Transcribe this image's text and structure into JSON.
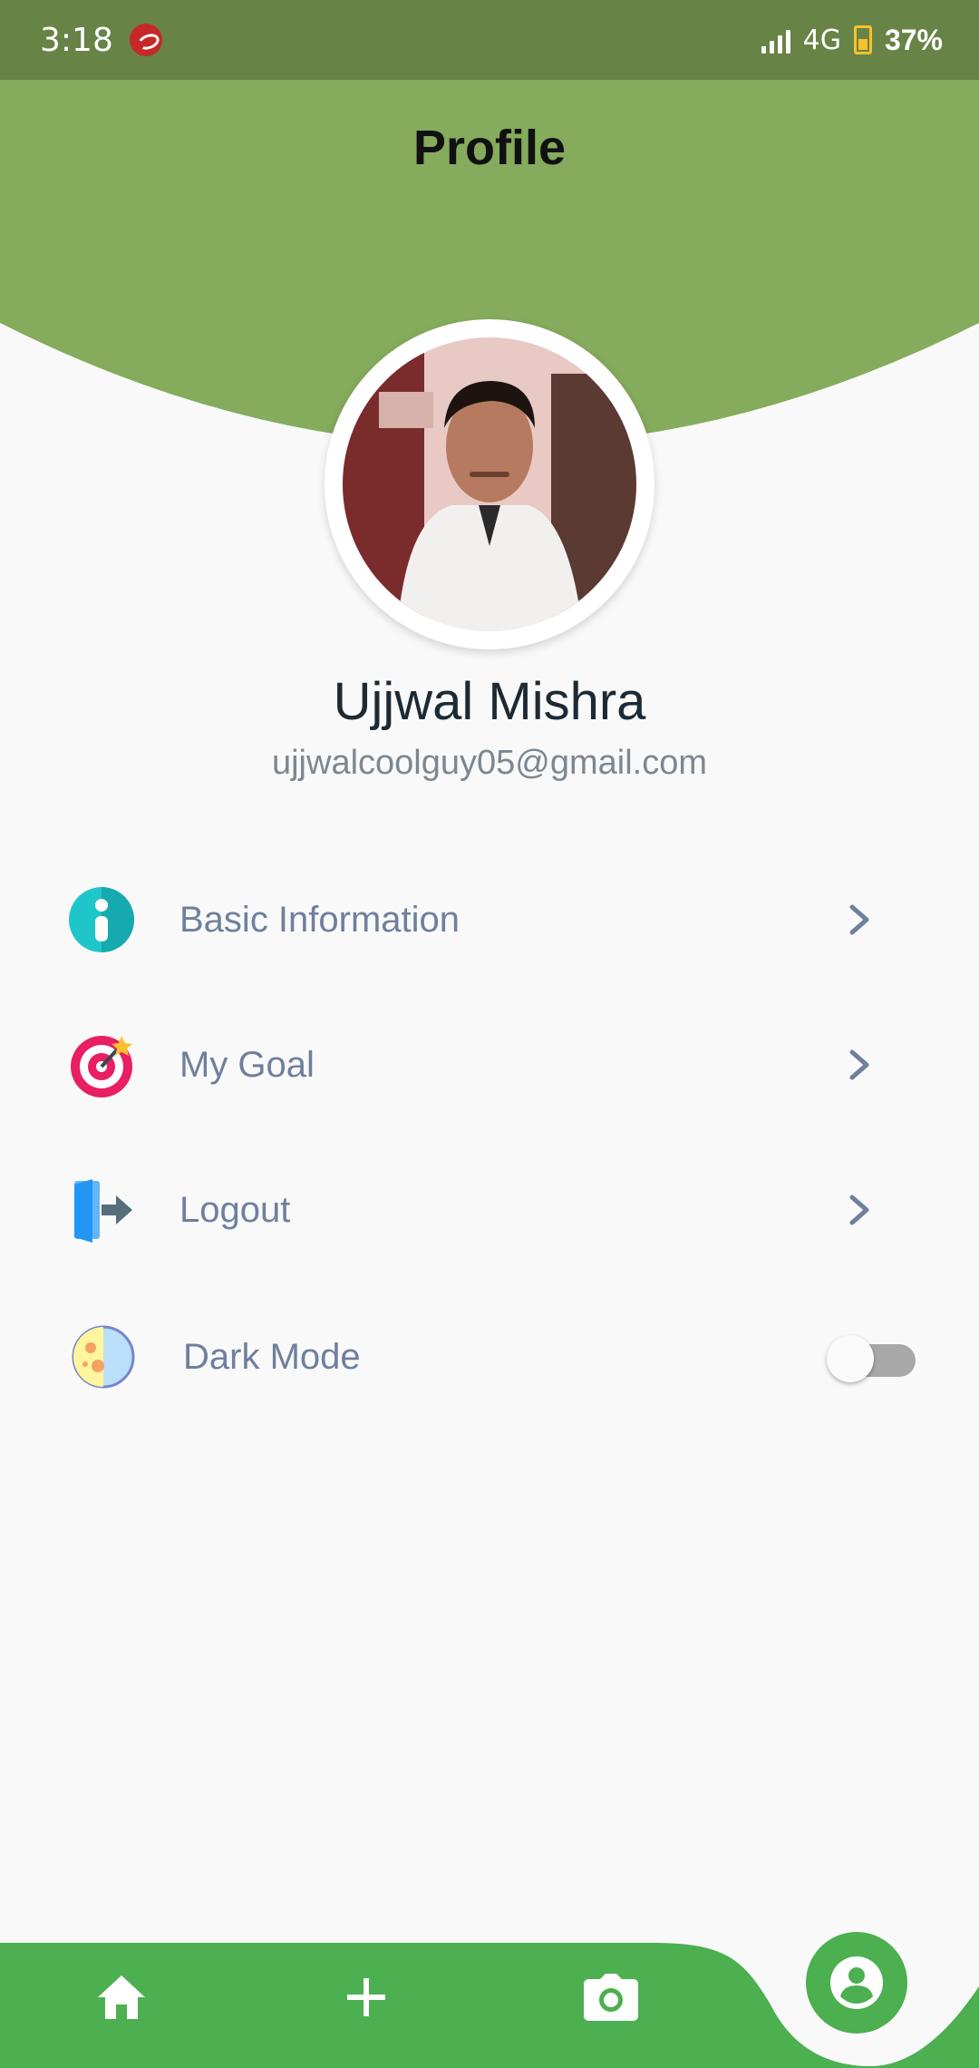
{
  "status_bar": {
    "time": "3:18",
    "network": "4G",
    "battery": "37%",
    "icons": [
      "carrier-icon",
      "signal-icon",
      "battery-icon"
    ]
  },
  "header": {
    "title": "Profile"
  },
  "profile": {
    "name": "Ujjwal Mishra",
    "email": "ujjwalcoolguy05@gmail.com"
  },
  "menu": {
    "items": [
      {
        "label": "Basic Information",
        "icon": "info-icon"
      },
      {
        "label": "My Goal",
        "icon": "target-icon"
      },
      {
        "label": "Logout",
        "icon": "logout-door-icon"
      }
    ],
    "dark_mode": {
      "label": "Dark Mode",
      "icon": "moon-icon",
      "enabled": false
    }
  },
  "bottom_nav": {
    "items": [
      {
        "icon": "home-icon"
      },
      {
        "icon": "plus-icon"
      },
      {
        "icon": "camera-icon"
      },
      {
        "icon": "account-icon",
        "active": true
      }
    ]
  },
  "colors": {
    "status_bar": "#678346",
    "header": "#85ab5c",
    "nav": "#4caf50",
    "menu_text": "#6f7f9e"
  }
}
